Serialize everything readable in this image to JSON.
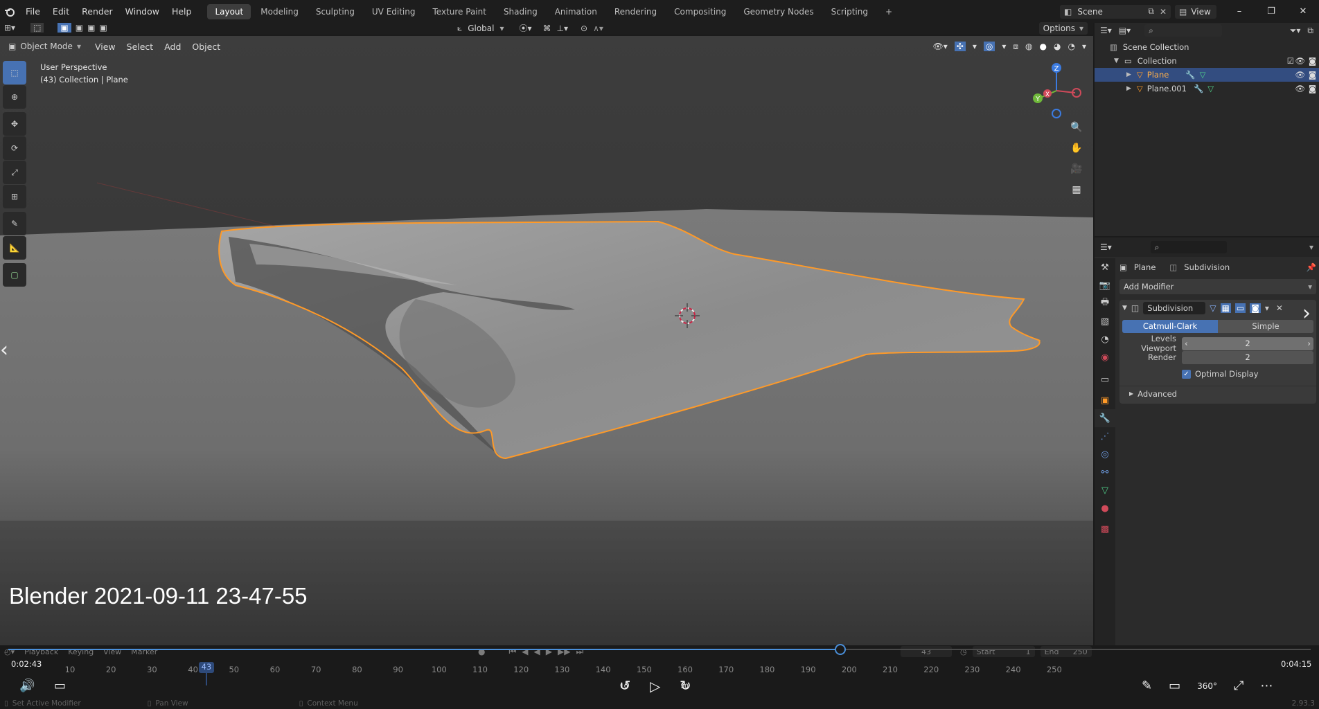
{
  "topbar": {
    "menus": [
      "File",
      "Edit",
      "Render",
      "Window",
      "Help"
    ],
    "workspaces": [
      "Layout",
      "Modeling",
      "Sculpting",
      "UV Editing",
      "Texture Paint",
      "Shading",
      "Animation",
      "Rendering",
      "Compositing",
      "Geometry Nodes",
      "Scripting"
    ],
    "active_workspace": "Layout",
    "add_tab": "+",
    "scene_label": "Scene",
    "viewlayer_label": "View"
  },
  "header": {
    "mode": "Object Mode",
    "menus": [
      "View",
      "Select",
      "Add",
      "Object"
    ],
    "orientation": "Global",
    "options": "Options"
  },
  "viewport": {
    "perspective": "User Perspective",
    "collection_info": "(43) Collection | Plane",
    "watermark": "Blender 2021-09-11 23-47-55",
    "gizmo": {
      "x": "X",
      "y": "Y",
      "z": "Z"
    }
  },
  "outliner": {
    "scene_collection": "Scene Collection",
    "collection": "Collection",
    "objects": [
      "Plane",
      "Plane.001"
    ],
    "selected": "Plane"
  },
  "properties": {
    "breadcrumb_object": "Plane",
    "breadcrumb_modifier": "Subdivision",
    "add_modifier": "Add Modifier",
    "modifier_name": "Subdivision",
    "catmull": "Catmull-Clark",
    "simple": "Simple",
    "levels_viewport_label": "Levels Viewport",
    "levels_viewport_value": "2",
    "render_label": "Render",
    "render_value": "2",
    "optimal_display": "Optimal Display",
    "advanced": "Advanced"
  },
  "timeline": {
    "menus": [
      "Playback",
      "Keying",
      "View",
      "Marker"
    ],
    "current_frame": "43",
    "start_label": "Start",
    "start_value": "1",
    "end_label": "End",
    "end_value": "250",
    "ticks": [
      "10",
      "20",
      "30",
      "40",
      "50",
      "60",
      "70",
      "80",
      "90",
      "100",
      "110",
      "120",
      "130",
      "140",
      "150",
      "160",
      "170",
      "180",
      "190",
      "200",
      "210",
      "220",
      "230",
      "240",
      "250"
    ],
    "elapsed": "0:02:43",
    "duration": "0:04:15",
    "rewind_label": "10",
    "forward_label": "30",
    "progress": 0.639
  },
  "statusbar": {
    "left": "Set Active Modifier",
    "middle": "Pan View",
    "right": "Context Menu",
    "version": "2.93.3"
  },
  "colors": {
    "accent": "#4772b3",
    "select_outline": "#ff9a28",
    "selected_row": "#334d80"
  }
}
